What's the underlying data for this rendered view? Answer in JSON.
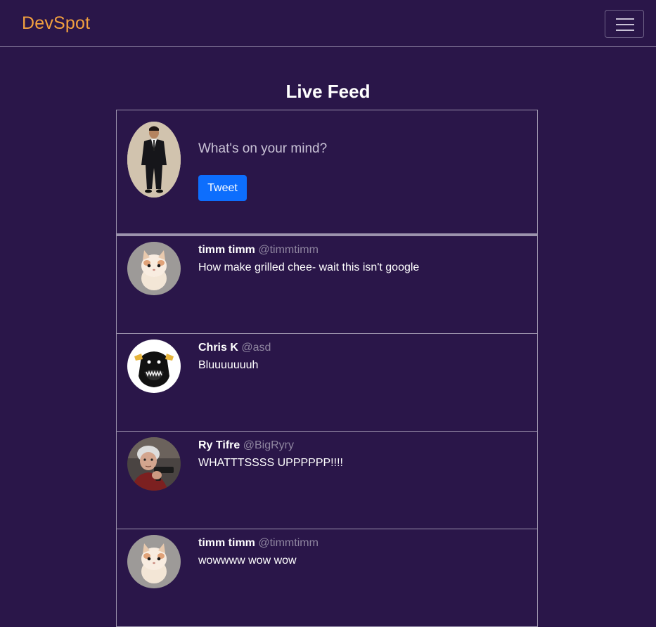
{
  "navbar": {
    "brand": "DevSpot",
    "toggle_icon": "hamburger-menu-icon"
  },
  "feed": {
    "title": "Live Feed",
    "composer": {
      "placeholder": "What's on your mind?",
      "button_label": "Tweet",
      "avatar_icon": "user-photo-avatar"
    },
    "posts": [
      {
        "name": "timm timm",
        "handle": "@timmtimm",
        "text": "How make grilled chee- wait this isn't google",
        "avatar": "kitten-avatar"
      },
      {
        "name": "Chris K",
        "handle": "@asd",
        "text": "Bluuuuuuuh",
        "avatar": "black-creature-avatar"
      },
      {
        "name": "Ry Tifre",
        "handle": "@BigRyry",
        "text": "WHATTTSSSS UPPPPPP!!!!",
        "avatar": "old-lady-avatar"
      },
      {
        "name": "timm timm",
        "handle": "@timmtimm",
        "text": "wowwww wow wow",
        "avatar": "kitten-avatar"
      }
    ]
  },
  "colors": {
    "background": "#2a1649",
    "brand": "#f2a03f",
    "primary_button": "#0d6efd",
    "handle": "#8f86a0",
    "border": "#9c93ad"
  }
}
